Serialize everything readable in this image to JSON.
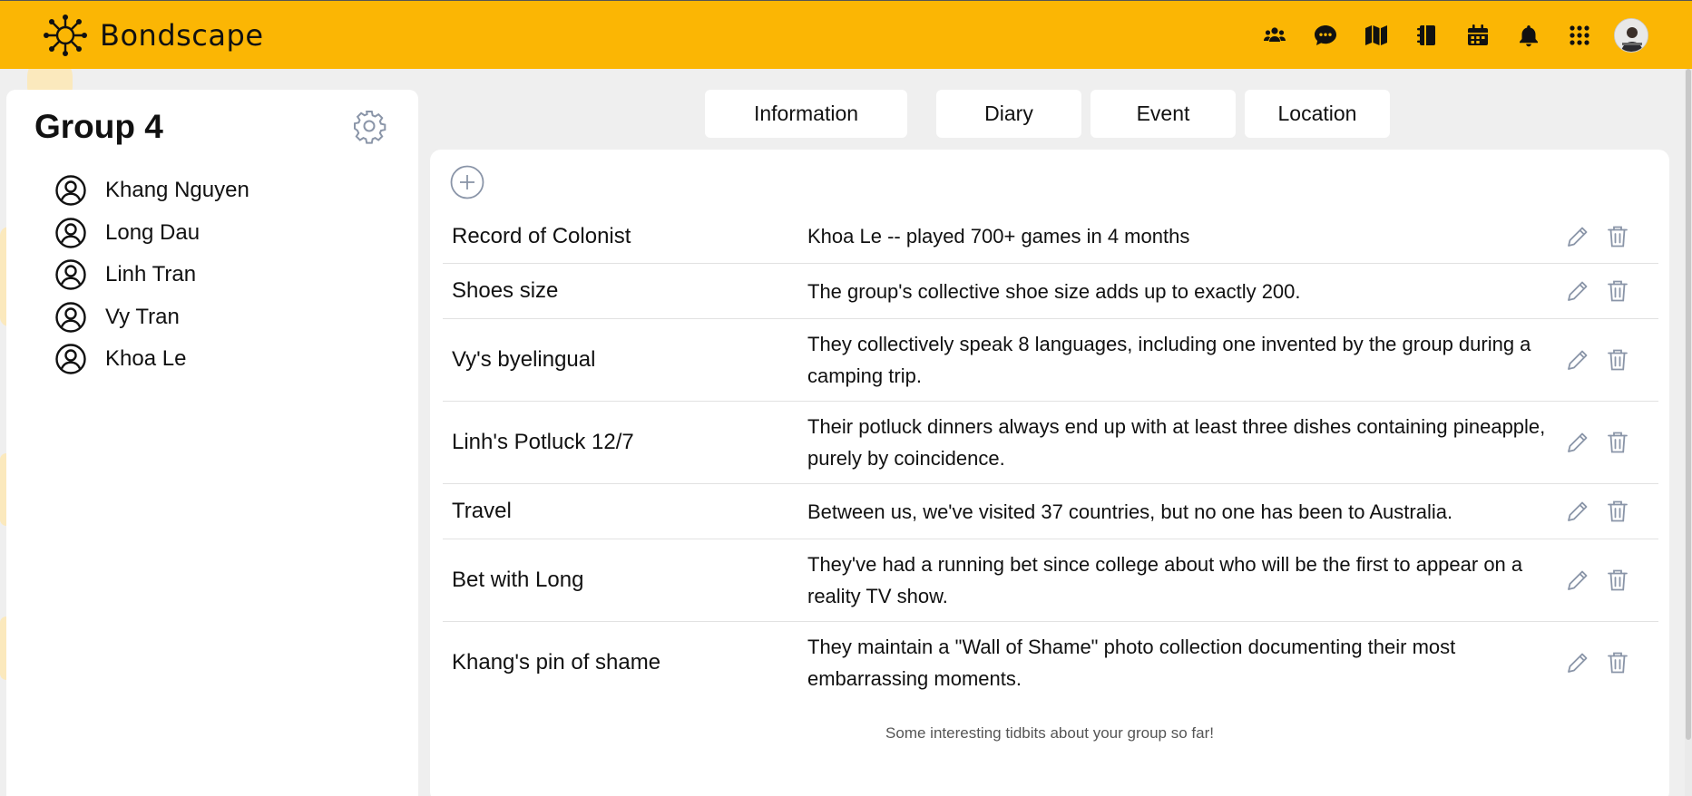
{
  "app": {
    "name": "Bondscape"
  },
  "nav": {
    "icons": [
      "groups-icon",
      "chat-icon",
      "map-icon",
      "book-icon",
      "calendar-icon",
      "bell-icon",
      "apps-grid-icon"
    ]
  },
  "sidebar": {
    "group_title": "Group 4",
    "members": [
      {
        "name": "Khang Nguyen"
      },
      {
        "name": "Long Dau"
      },
      {
        "name": "Linh Tran"
      },
      {
        "name": "Vy Tran"
      },
      {
        "name": "Khoa Le"
      }
    ]
  },
  "tabs": [
    {
      "label": "Information"
    },
    {
      "label": "Diary"
    },
    {
      "label": "Event"
    },
    {
      "label": "Location"
    }
  ],
  "entries": [
    {
      "title": "Record of Colonist",
      "description": "Khoa Le -- played 700+ games in 4 months"
    },
    {
      "title": "Shoes size",
      "description": "The group's collective shoe size adds up to exactly 200."
    },
    {
      "title": "Vy's byelingual",
      "description": "They collectively speak 8 languages, including one invented by the group during a camping trip."
    },
    {
      "title": "Linh's Potluck 12/7",
      "description": "Their potluck dinners always end up with at least three dishes containing pineapple, purely by coincidence."
    },
    {
      "title": "Travel",
      "description": "Between us, we've visited 37 countries, but no one has been to Australia."
    },
    {
      "title": "Bet with Long",
      "description": "They've had a running bet since college about who will be the first to appear on a reality TV show."
    },
    {
      "title": "Khang's pin of shame",
      "description": "They maintain a \"Wall of Shame\" photo collection documenting their most embarrassing moments."
    }
  ],
  "footer_note": "Some interesting tidbits about your group so far!",
  "colors": {
    "topbar": "#fbb604",
    "background": "#efefef",
    "panel": "#ffffff",
    "action_icon": "#8a95a8"
  }
}
